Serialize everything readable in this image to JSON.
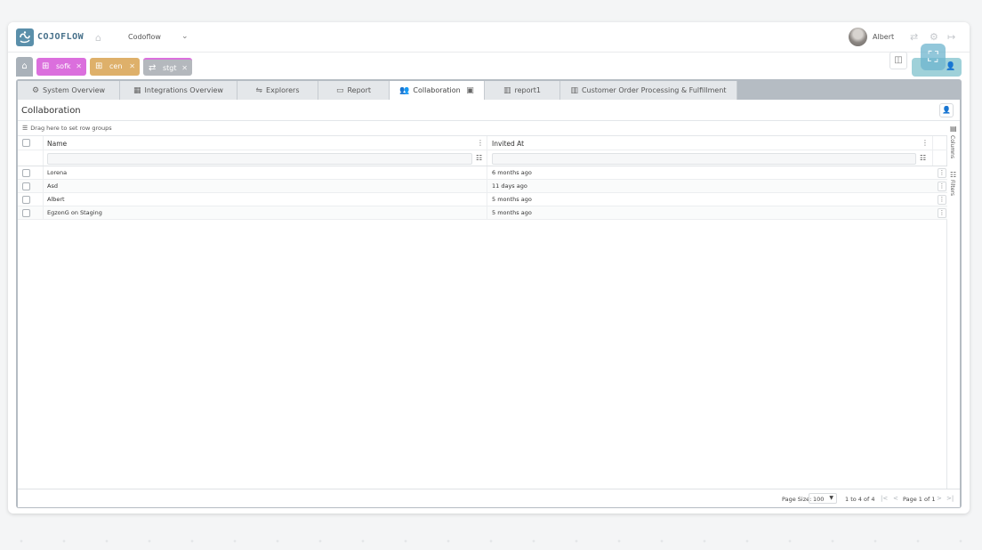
{
  "header": {
    "logo_text": "COJOFLOW",
    "project": "Codoflow",
    "user_name": "Albert"
  },
  "workspace_tabs": [
    {
      "label": "sofk",
      "color": "#db6fdd",
      "icon": "grid-icon"
    },
    {
      "label": "cen",
      "color": "#deb06a",
      "icon": "grid-icon"
    },
    {
      "label": "stgt",
      "color": "#b4b8bd",
      "icon": "sync-icon"
    }
  ],
  "view_tabs": [
    {
      "label": "System Overview",
      "icon": "gear-icon"
    },
    {
      "label": "Integrations Overview",
      "icon": "dashboard-icon"
    },
    {
      "label": "Explorers",
      "icon": "flow-icon"
    },
    {
      "label": "Report",
      "icon": "comment-icon"
    },
    {
      "label": "Collaboration",
      "icon": "users-icon",
      "active": true
    },
    {
      "label": "report1",
      "icon": "map-icon"
    },
    {
      "label": "Customer Order Processing & Fulfillment",
      "icon": "map-icon"
    }
  ],
  "content": {
    "title": "Collaboration",
    "row_groups_hint": "Drag here to set row groups"
  },
  "grid": {
    "columns": [
      "Name",
      "Invited At"
    ],
    "rows": [
      {
        "name": "Lorena",
        "invited_at": "6 months ago"
      },
      {
        "name": "Asd",
        "invited_at": "11 days ago"
      },
      {
        "name": "Albert",
        "invited_at": "5 months ago"
      },
      {
        "name": "EgzonG on Staging",
        "invited_at": "5 months ago"
      }
    ],
    "side_panel": [
      "Columns",
      "Filters"
    ]
  },
  "paging": {
    "page_size_label": "Page Size:",
    "page_size": "100",
    "range": "1 to 4 of 4",
    "page_info": "Page 1 of 1"
  },
  "colors": {
    "accent": "#5a8faa",
    "share_button": "#9fd1d9"
  }
}
